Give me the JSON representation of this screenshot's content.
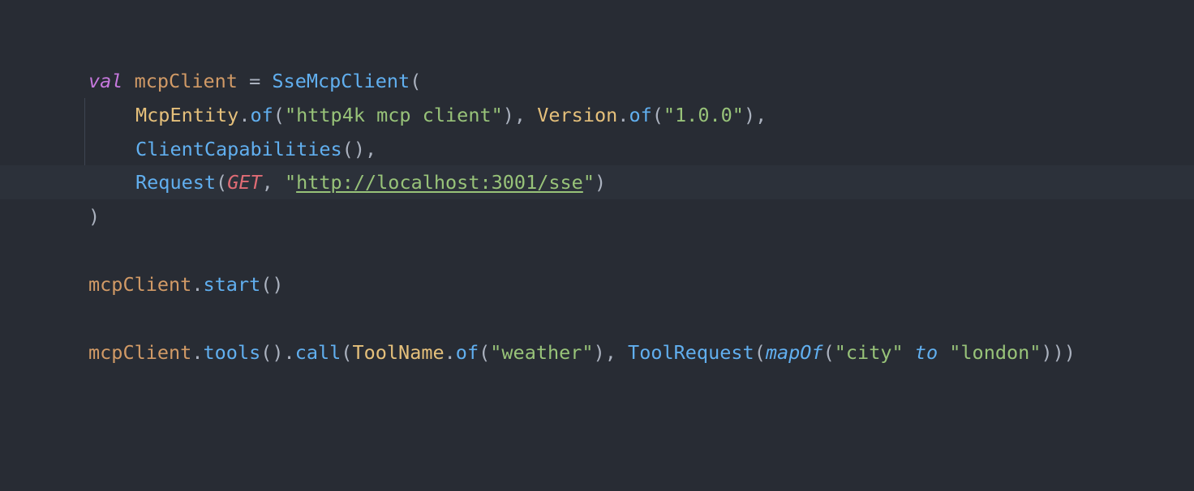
{
  "editor": {
    "theme_colors": {
      "background": "#282c34",
      "current_line": "#2c313a",
      "keyword": "#c678dd",
      "variable": "#d19a66",
      "function": "#61afef",
      "class": "#e5c07b",
      "string": "#98c379",
      "constant": "#e06c75",
      "punctuation": "#abb2bf"
    },
    "code": {
      "l1": {
        "kw_val": "val",
        "var": "mcpClient",
        "eq": " = ",
        "ctor": "SseMcpClient",
        "open": "("
      },
      "l2": {
        "cls1": "McpEntity",
        "dot1": ".",
        "fn1": "of",
        "p1": "(",
        "str1": "\"http4k mcp client\"",
        "p2": "), ",
        "cls2": "Version",
        "dot2": ".",
        "fn2": "of",
        "p3": "(",
        "str2": "\"1.0.0\"",
        "p4": "),"
      },
      "l3": {
        "fn": "ClientCapabilities",
        "p": "(),"
      },
      "l4": {
        "fn": "Request",
        "p1": "(",
        "const": "GET",
        "p2": ", ",
        "q1": "\"",
        "url": "http://localhost:3001/sse",
        "q2": "\"",
        "p3": ")"
      },
      "l5": {
        "close": ")"
      },
      "l6": {
        "var": "mcpClient",
        "dot": ".",
        "fn": "start",
        "p": "()"
      },
      "l7": {
        "var": "mcpClient",
        "dot1": ".",
        "fn1": "tools",
        "p1": "().",
        "fn2": "call",
        "p2": "(",
        "cls": "ToolName",
        "dot2": ".",
        "fn3": "of",
        "p3": "(",
        "str1": "\"weather\"",
        "p4": "), ",
        "fn4": "ToolRequest",
        "p5": "(",
        "fn5": "mapOf",
        "p6": "(",
        "str2": "\"city\"",
        "sp1": " ",
        "infix": "to",
        "sp2": " ",
        "str3": "\"london\"",
        "p7": ")))"
      }
    }
  }
}
